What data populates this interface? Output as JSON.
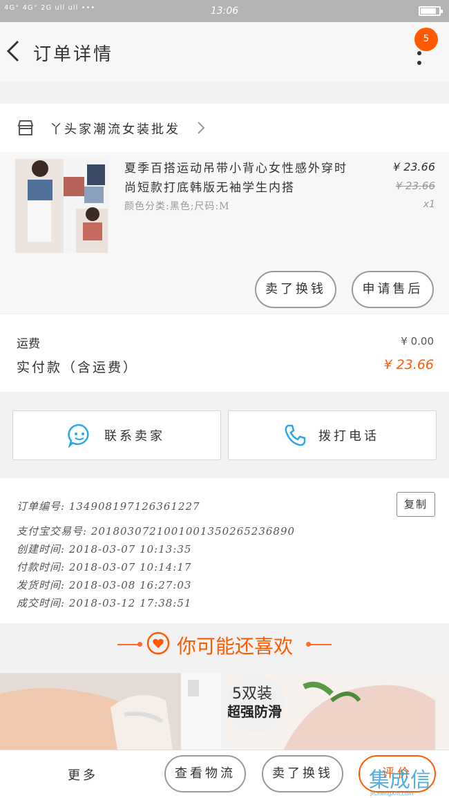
{
  "status_bar": {
    "signal": "4G⁺ 4G⁺ 2G ull ull •••",
    "time": "13:06"
  },
  "header": {
    "title": "订单详情",
    "badge": "5"
  },
  "shop": {
    "name": "丫头家潮流女装批发"
  },
  "item": {
    "description": "夏季百搭运动吊带小背心女性感外穿时尚短款打底韩版无袖学生内搭",
    "spec": "颜色分类:黑色;尺码:M",
    "price": "¥ 23.66",
    "original_price": "¥ 23.66",
    "quantity": "x1",
    "buttons": [
      "卖了换钱",
      "申请售后"
    ]
  },
  "payment": {
    "shipping_label": "运费",
    "shipping_value": "¥ 0.00",
    "total_label": "实付款（含运费）",
    "total_value": "¥ 23.66"
  },
  "contact": {
    "seller_label": "联系卖家",
    "call_label": "拨打电话"
  },
  "order_info": {
    "lines": [
      "订单编号: 134908197126361227",
      "支付宝交易号: 2018030721001001350265236890",
      "创建时间: 2018-03-07 10:13:35",
      "付款时间: 2018-03-07 10:14:17",
      "发货时间: 2018-03-08 16:27:03",
      "成交时间: 2018-03-12 17:38:51"
    ],
    "copy_label": "复制"
  },
  "recommend": {
    "title": "你可能还喜欢"
  },
  "products": [
    {
      "tag_line1": "",
      "tag_line2": ""
    },
    {
      "tag_line1": "5双装",
      "tag_line2": "超强防滑"
    }
  ],
  "bottom_bar": {
    "more_label": "更多",
    "buttons": [
      "查看物流",
      "卖了换钱",
      "评价"
    ]
  },
  "watermark": {
    "text": "集成信",
    "sub": "JiChengXin.com"
  },
  "colors": {
    "accent": "#ff5a00",
    "watermark": "#3aa0d8"
  }
}
